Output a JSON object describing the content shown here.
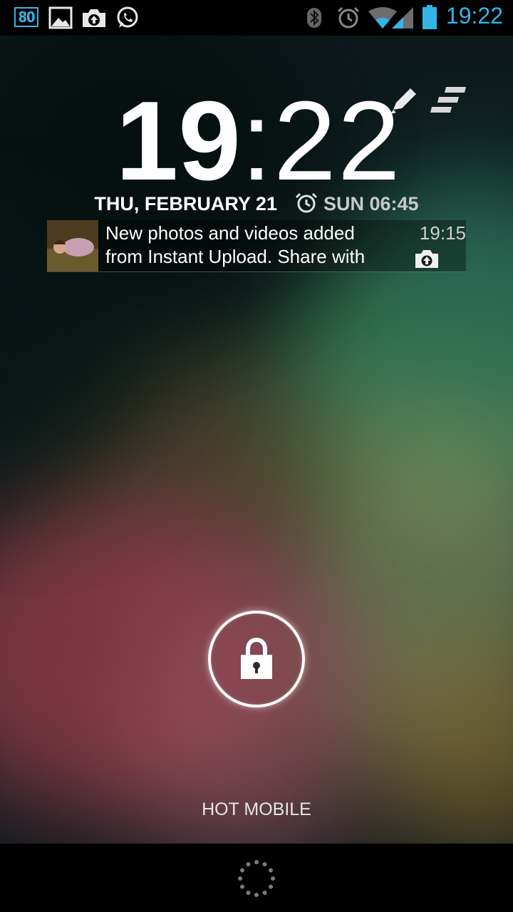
{
  "status_bar": {
    "badge": "80",
    "time": "19:22",
    "left_icons": [
      "notification-badge-icon",
      "gallery-image-icon",
      "instant-upload-camera-icon",
      "whatsapp-icon"
    ],
    "right_icons": [
      "bluetooth-icon",
      "alarm-clock-icon",
      "wifi-icon",
      "cell-signal-icon",
      "battery-icon"
    ],
    "accent_color": "#33b5e5"
  },
  "lockscreen": {
    "clock_hours": "19",
    "clock_separator": ":",
    "clock_minutes": "22",
    "date": "THU, FEBRUARY 21",
    "alarm": "SUN 06:45",
    "widget_icons": [
      "pencil-icon",
      "menu-stack-icon"
    ],
    "notification": {
      "line1": "New photos and videos added",
      "line2": "from Instant Upload. Share with",
      "time": "19:15",
      "icon": "instant-upload-camera-icon"
    },
    "lock_icon": "padlock-icon",
    "carrier": "HOT MOBILE"
  },
  "nav_bar": {
    "icons": [
      "loading-spinner-icon"
    ]
  }
}
